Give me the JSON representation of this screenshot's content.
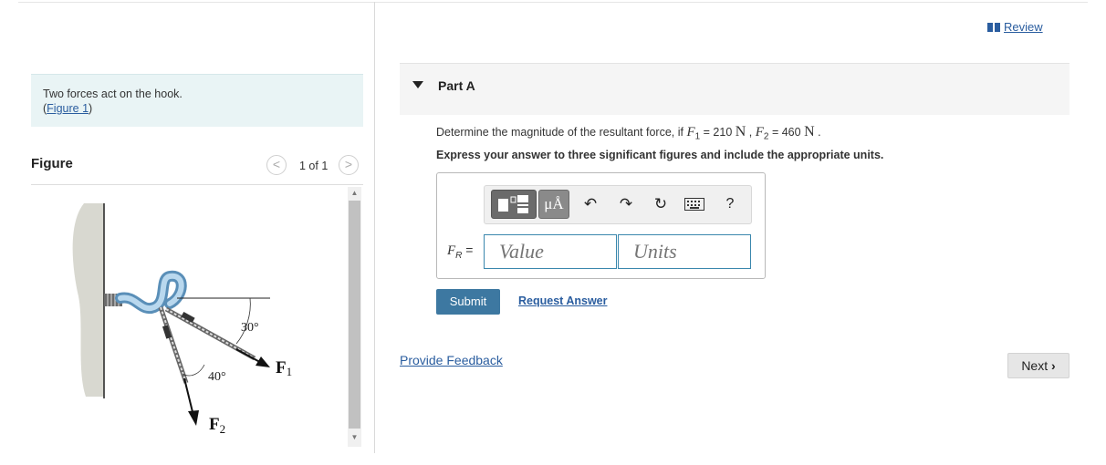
{
  "intro": {
    "text": "Two forces act on the hook.",
    "link_open": "(",
    "link_text": "Figure 1",
    "link_close": ")"
  },
  "figure_panel": {
    "title": "Figure",
    "pager": "1 of 1",
    "prev_symbol": "<",
    "next_symbol": ">",
    "diagram_labels": {
      "angle_top": "30°",
      "angle_bottom": "40°",
      "force1": "F",
      "force1_sub": "1",
      "force2": "F",
      "force2_sub": "2"
    }
  },
  "review": {
    "label": "Review"
  },
  "part": {
    "title": "Part A"
  },
  "question": {
    "prefix": "Determine the magnitude of the resultant force, if ",
    "f1_symbol": "F",
    "f1_sub": "1",
    "f1_eq": " = 210 ",
    "f1_unit": "N",
    "sep": " , ",
    "f2_symbol": "F",
    "f2_sub": "2",
    "f2_eq": " = 460 ",
    "f2_unit": "N",
    "end": " ."
  },
  "instruction": "Express your answer to three significant figures and include the appropriate units.",
  "toolbar": {
    "templates_icon": "templates-icon",
    "units_label": "μÅ",
    "undo": "↶",
    "redo": "↷",
    "reset": "↻",
    "keyboard_icon": "keyboard-icon",
    "help": "?"
  },
  "answer": {
    "label_var": "F",
    "label_sub": "R",
    "label_eq": " =",
    "value_placeholder": "Value",
    "units_placeholder": "Units"
  },
  "actions": {
    "submit": "Submit",
    "request_answer": "Request Answer",
    "feedback": "Provide Feedback",
    "next": "Next"
  },
  "colors": {
    "intro_bg": "#e9f4f5",
    "link": "#2a5d9f",
    "submit_bg": "#3d78a1",
    "input_border": "#3a87ad"
  }
}
